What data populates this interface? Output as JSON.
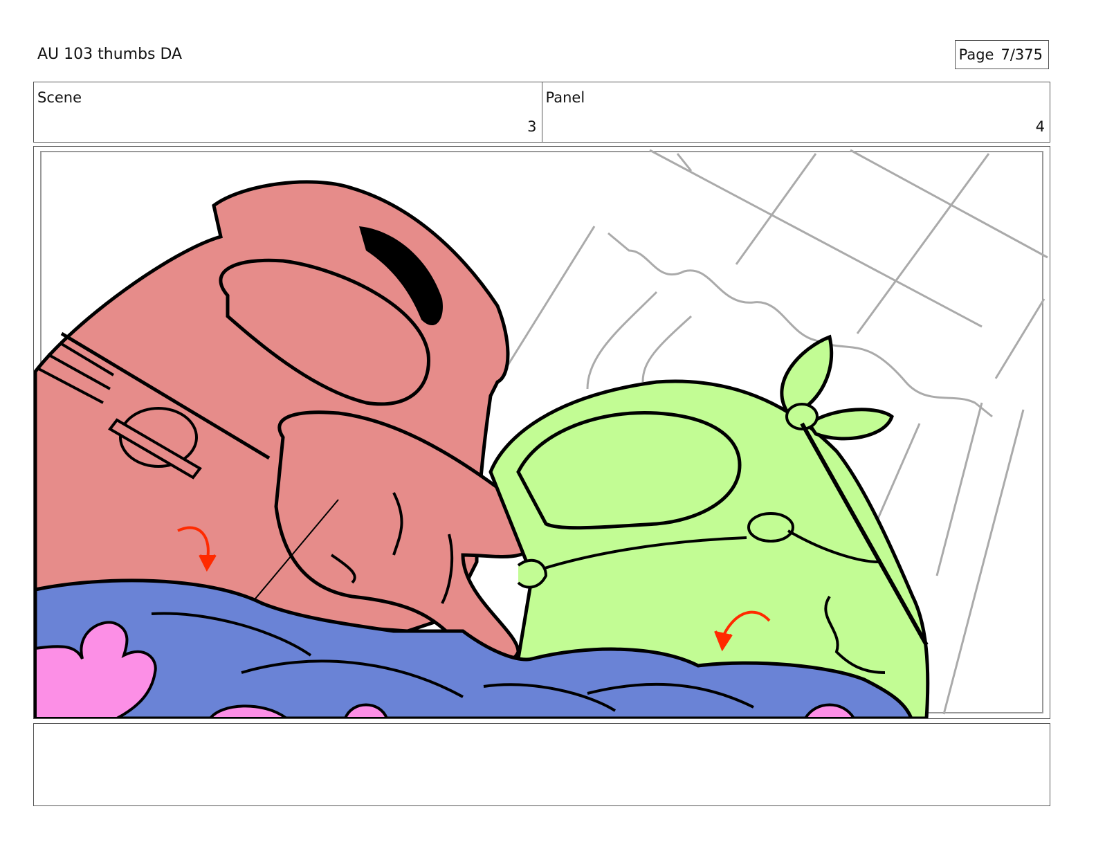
{
  "header": {
    "doc_title": "AU 103 thumbs DA",
    "page_label": "Page",
    "page_value": "7/375"
  },
  "fields": {
    "scene_label": "Scene",
    "scene_value": "3",
    "panel_label": "Panel",
    "panel_value": "4"
  },
  "panel_art": {
    "description_colors": {
      "pink_character": "#e68c8a",
      "green_character": "#c2fc94",
      "blanket": "#6a83d6",
      "blanket_flowers": "#fc8fe6",
      "motion_arrows": "#ff2a00",
      "background_lines": "#aaaaaa"
    }
  },
  "notes": {
    "text": ""
  }
}
